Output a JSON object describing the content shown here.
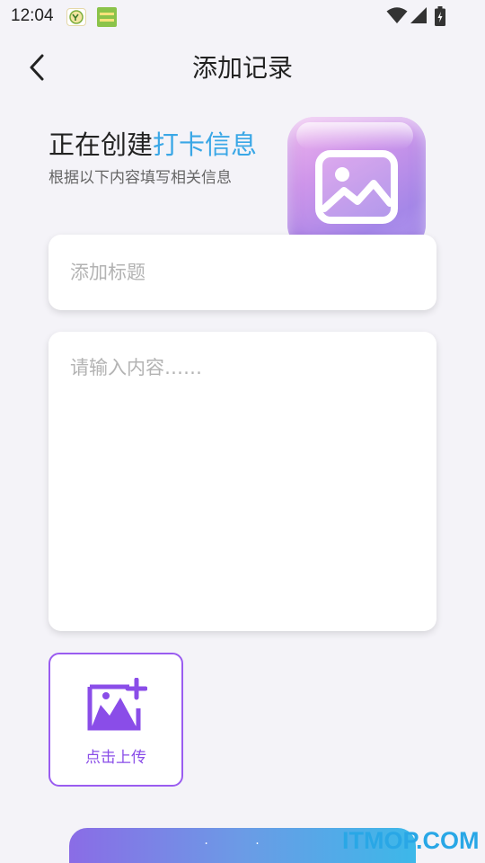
{
  "status_bar": {
    "time": "12:04",
    "icons": [
      "notification-app-icon",
      "notification-app-icon",
      "wifi-icon",
      "signal-icon",
      "battery-icon"
    ]
  },
  "header": {
    "title": "添加记录",
    "back_icon": "chevron-left-icon"
  },
  "intro": {
    "heading_prefix": "正在创建",
    "heading_accent": "打卡信息",
    "subtitle": "根据以下内容填写相关信息",
    "hero_icon": "image-icon"
  },
  "form": {
    "title_placeholder": "添加标题",
    "title_value": "",
    "content_placeholder": "请输入内容……",
    "content_value": ""
  },
  "upload": {
    "label": "点击上传",
    "icon": "add-image-icon"
  },
  "submit": {
    "label": "· ·"
  },
  "watermark": "ITMOP.COM",
  "colors": {
    "accent_blue": "#3aa7e6",
    "accent_purple": "#8a4de8",
    "background": "#f4f3f8"
  }
}
